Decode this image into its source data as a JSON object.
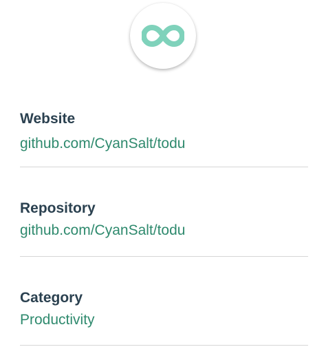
{
  "app": {
    "logo_icon": "infinity-icon",
    "accent_color": "#7fd2bb"
  },
  "details": [
    {
      "label": "Website",
      "value": "github.com/CyanSalt/todu"
    },
    {
      "label": "Repository",
      "value": "github.com/CyanSalt/todu"
    },
    {
      "label": "Category",
      "value": "Productivity"
    }
  ],
  "colors": {
    "label": "#2b4150",
    "value": "#2f8a6e",
    "divider": "#d6d6d6"
  }
}
